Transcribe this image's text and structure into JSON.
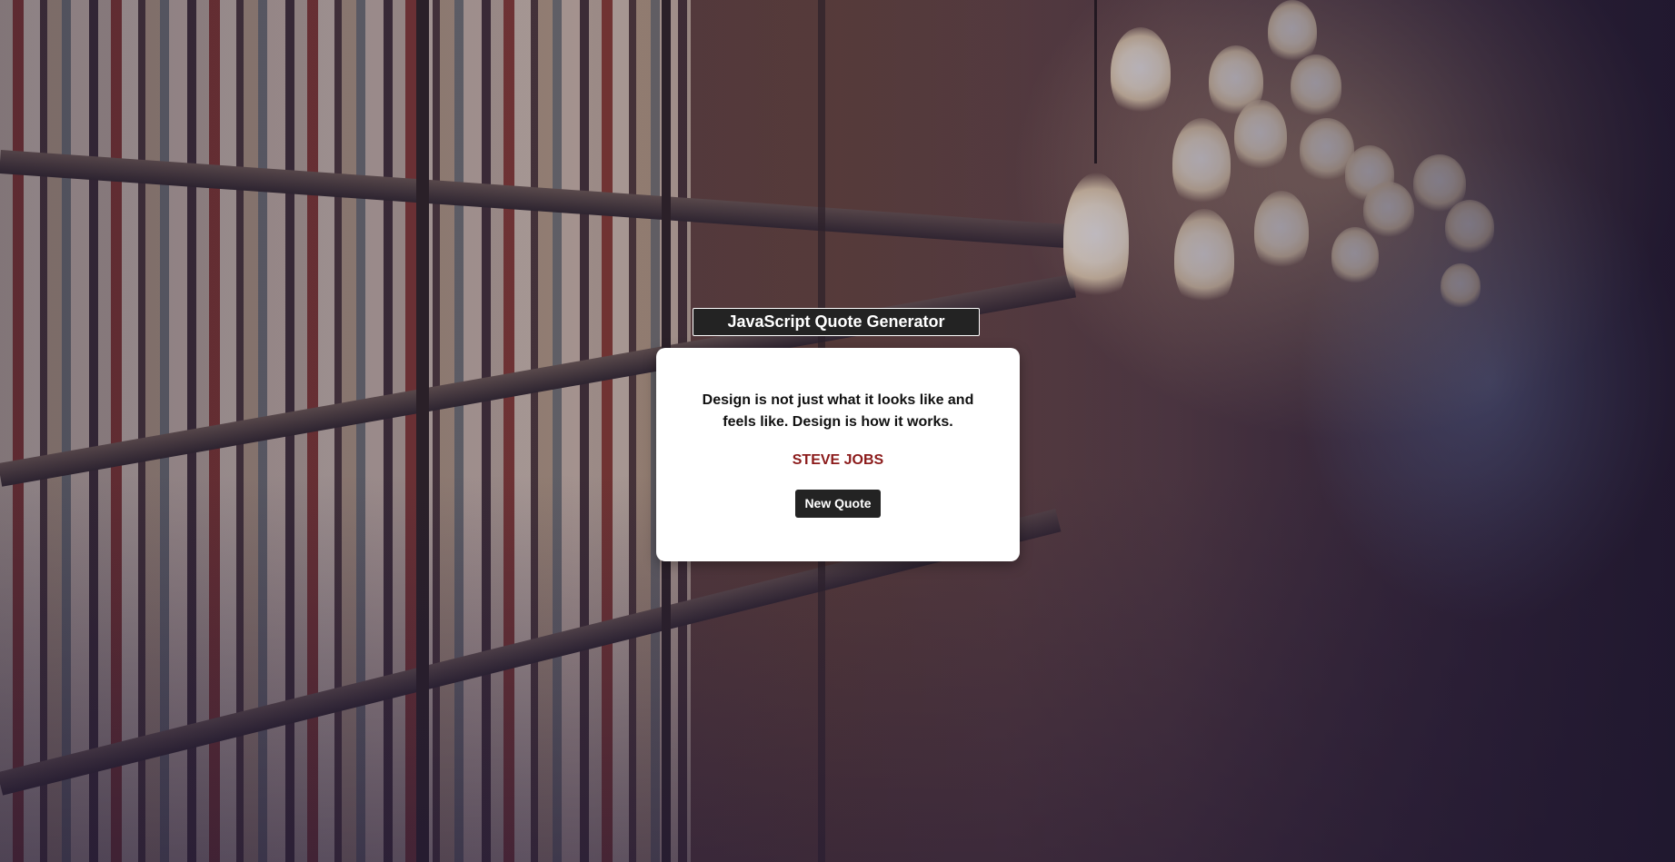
{
  "header": {
    "title": "JavaScript Quote Generator"
  },
  "quote": {
    "text": "Design is not just what it looks like and feels like. Design is how it works.",
    "author": "STEVE JOBS"
  },
  "actions": {
    "new_quote_label": "New Quote"
  },
  "colors": {
    "title_background": "#232323",
    "card_background": "#ffffff",
    "author_text": "#8b1a1a",
    "button_background": "#232323"
  }
}
